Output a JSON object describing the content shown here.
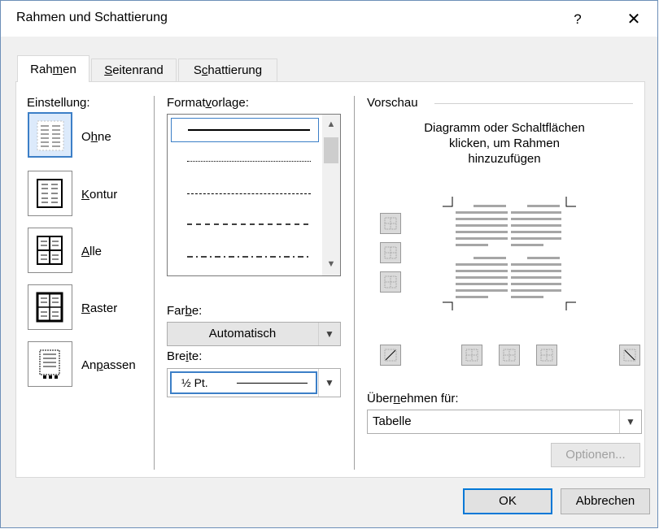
{
  "dialog": {
    "title": "Rahmen und Schattierung",
    "help": "?",
    "close": "✕"
  },
  "tabs": [
    {
      "pre": "Rah",
      "key": "m",
      "post": "en",
      "active": true
    },
    {
      "pre": "",
      "key": "S",
      "post": "eitenrand",
      "active": false
    },
    {
      "pre": "S",
      "key": "c",
      "post": "hattierung",
      "active": false
    }
  ],
  "settings": {
    "heading": "Einstellung:",
    "items": [
      {
        "pre": "O",
        "key": "h",
        "post": "ne",
        "icon": "none-border-icon",
        "selected": true
      },
      {
        "pre": "",
        "key": "K",
        "post": "ontur",
        "icon": "box-border-icon",
        "selected": false
      },
      {
        "pre": "",
        "key": "A",
        "post": "lle",
        "icon": "all-border-icon",
        "selected": false
      },
      {
        "pre": "",
        "key": "R",
        "post": "aster",
        "icon": "grid-border-icon",
        "selected": false
      },
      {
        "pre": "An",
        "key": "p",
        "post": "assen",
        "icon": "custom-border-icon",
        "selected": false
      }
    ]
  },
  "style": {
    "label_pre": "Format",
    "label_key": "v",
    "label_post": "orlage:",
    "options": [
      "solid",
      "dotted",
      "dashed-small",
      "dashed",
      "dash-dot"
    ],
    "selected_index": 0
  },
  "color": {
    "label_pre": "Far",
    "label_key": "b",
    "label_post": "e:",
    "value": "Automatisch"
  },
  "width": {
    "label_pre": "Bre",
    "label_key": "i",
    "label_post": "te:",
    "value": "½ Pt."
  },
  "preview": {
    "heading": "Vorschau",
    "instruction_line1": "Diagramm oder Schaltflächen",
    "instruction_line2": "klicken, um Rahmen",
    "instruction_line3": "hinzuzufügen"
  },
  "apply": {
    "label_pre": "Über",
    "label_key": "n",
    "label_post": "ehmen für:",
    "value": "Tabelle"
  },
  "buttons": {
    "options": "Optionen...",
    "ok": "OK",
    "cancel": "Abbrechen"
  },
  "colors": {
    "accent": "#0078d7",
    "selection": "#3c7fc7",
    "disabled_text": "#a0a0a0"
  }
}
